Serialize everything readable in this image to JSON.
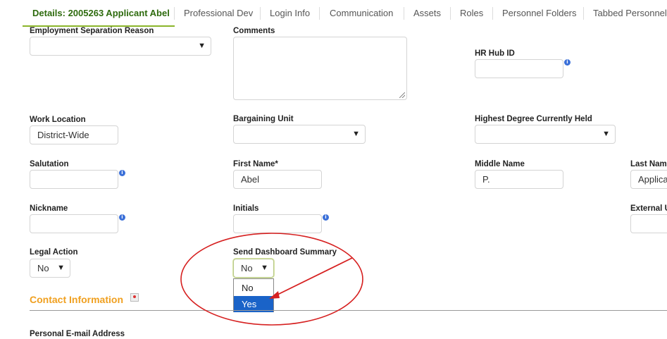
{
  "tabs": [
    {
      "label": "Details: 2005263 Applicant Abel"
    },
    {
      "label": "Professional Dev"
    },
    {
      "label": "Login Info"
    },
    {
      "label": "Communication"
    },
    {
      "label": "Assets"
    },
    {
      "label": "Roles"
    },
    {
      "label": "Personnel Folders"
    },
    {
      "label": "Tabbed Personnel"
    }
  ],
  "fields": {
    "separation_reason": {
      "label": "Employment Separation Reason",
      "value": ""
    },
    "comments": {
      "label": "Comments",
      "value": ""
    },
    "hr_hub_id": {
      "label": "HR Hub ID",
      "value": ""
    },
    "work_location": {
      "label": "Work Location",
      "value": "District-Wide"
    },
    "bargaining_unit": {
      "label": "Bargaining Unit",
      "value": ""
    },
    "highest_degree": {
      "label": "Highest Degree Currently Held",
      "value": ""
    },
    "salutation": {
      "label": "Salutation",
      "value": ""
    },
    "first_name": {
      "label": "First Name*",
      "value": "Abel"
    },
    "middle_name": {
      "label": "Middle Name",
      "value": "P."
    },
    "last_name": {
      "label": "Last Name",
      "value": "Applicant"
    },
    "nickname": {
      "label": "Nickname",
      "value": ""
    },
    "initials": {
      "label": "Initials",
      "value": ""
    },
    "external": {
      "label": "External UID",
      "value": ""
    },
    "legal_action": {
      "label": "Legal Action",
      "value": "No"
    },
    "send_dashboard": {
      "label": "Send Dashboard Summary",
      "value": "No",
      "options": [
        "No",
        "Yes"
      ]
    }
  },
  "contact": {
    "title": "Contact Information"
  },
  "personal_email": {
    "label": "Personal E-mail Address"
  },
  "icons": {
    "chevron": "chevron-down-icon",
    "info": "info-icon",
    "map": "map-pin-icon"
  },
  "colors": {
    "accent": "#f0a020",
    "active_tab": "#2e6b0e",
    "tab_underline": "#8bb52a",
    "selected_option": "#1a63c8",
    "annotation": "#d62020"
  }
}
